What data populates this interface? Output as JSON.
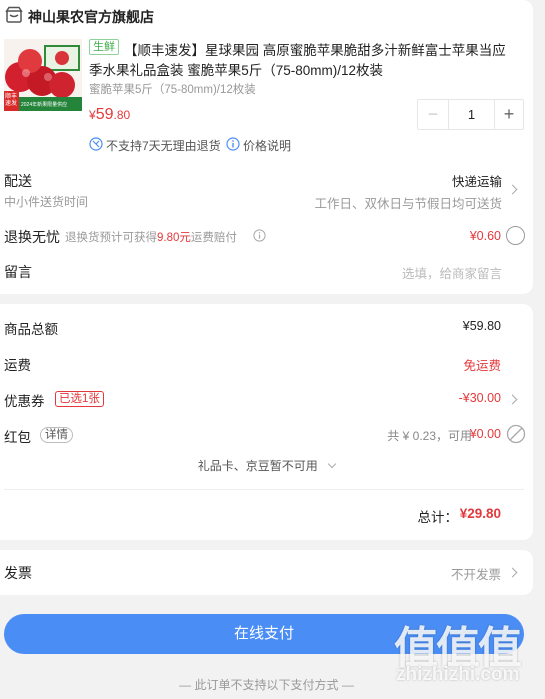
{
  "shop": {
    "name": "神山果农官方旗舰店"
  },
  "product": {
    "tag": "生鲜",
    "title_line1": "【顺丰速发】星球果园 高原蜜脆苹果脆甜多汁新鲜富士苹果当应",
    "title_line2": "季水果礼品盒装 蜜脆苹果5斤（75-80mm)/12枚装",
    "spec": "蜜脆苹果5斤（75-80mm)/12枚装",
    "price_symbol": "¥",
    "price_int": "59",
    "price_dec": ".80",
    "quantity": "1",
    "minus": "−",
    "plus": "+",
    "thumb_badge": "顺丰\n速发",
    "thumb_caption": "2024年新果限量供应",
    "notice_return": "不支持7天无理由退货",
    "notice_price": "价格说明"
  },
  "delivery": {
    "label": "配送",
    "sublabel": "中小件送货时间",
    "method": "快递运输",
    "time": "工作日、双休日与节假日均可送货"
  },
  "return_ins": {
    "label": "退换无忧",
    "desc_prefix": "退换货预计可获得",
    "desc_amount": "9.80元",
    "desc_suffix": "运费赔付",
    "price": "¥0.60"
  },
  "message": {
    "label": "留言",
    "placeholder": "选填，给商家留言"
  },
  "summary": {
    "total_goods_label": "商品总额",
    "total_goods_value": "¥59.80",
    "shipping_label": "运费",
    "shipping_value": "免运费",
    "coupon_label": "优惠券",
    "coupon_badge": "已选1张",
    "coupon_value": "-¥30.00",
    "redpacket_label": "红包",
    "redpacket_detail": "详情",
    "redpacket_desc": "共 ¥ 0.23，可用",
    "redpacket_value": "¥0.00",
    "giftcard_text": "礼品卡、京豆暂不可用",
    "total_label": "总计：",
    "total_value": "¥29.80"
  },
  "invoice": {
    "label": "发票",
    "value": "不开发票"
  },
  "pay": {
    "button": "在线支付",
    "footer": "— 此订单不支持以下支付方式 —"
  },
  "watermark": {
    "text": "值值值",
    "url": "zhizhizhi.com"
  },
  "colors": {
    "accent_red": "#e4393c",
    "pay_blue": "#4a8ef5",
    "notice_blue": "#4a8ef5",
    "tag_green": "#3fae4b"
  }
}
